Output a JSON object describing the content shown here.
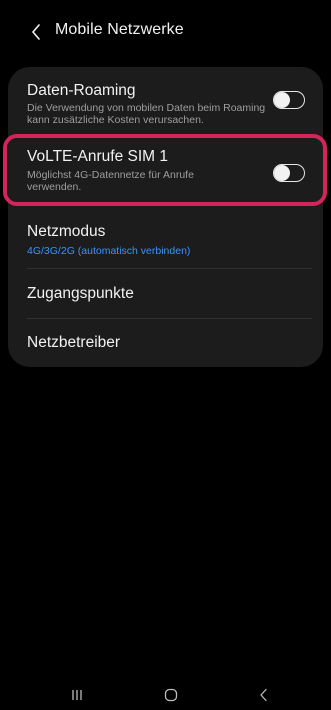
{
  "header": {
    "title": "Mobile Netzwerke",
    "back_icon": "chevron-left-icon"
  },
  "settings": {
    "data_roaming": {
      "title": "Daten-Roaming",
      "subtitle": "Die Verwendung von mobilen Daten beim Roaming kann zusätzliche Kosten verursachen.",
      "enabled": false
    },
    "volte": {
      "title": "VoLTE-Anrufe SIM 1",
      "subtitle": "Möglichst 4G-Datennetze für Anrufe verwenden.",
      "enabled": false
    },
    "network_mode": {
      "title": "Netzmodus",
      "value": "4G/3G/2G (automatisch verbinden)"
    },
    "access_points": {
      "title": "Zugangspunkte"
    },
    "network_operators": {
      "title": "Netzbetreiber"
    }
  },
  "navbar": {
    "recents_icon": "recents-icon",
    "home_icon": "home-icon",
    "back_icon": "back-chevron-icon"
  },
  "colors": {
    "background": "#000000",
    "card": "#1c1c1c",
    "accent_blue": "#3e91ff",
    "highlight": "#d4245c"
  }
}
